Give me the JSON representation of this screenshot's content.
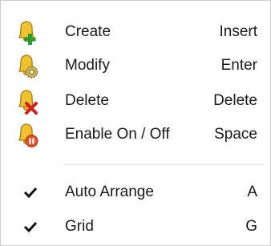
{
  "menu": {
    "items": [
      {
        "label": "Create",
        "shortcut": "Insert",
        "icon": "bell-add-icon",
        "badge_color": "#2e9b2e"
      },
      {
        "label": "Modify",
        "shortcut": "Enter",
        "icon": "bell-gear-icon",
        "badge_color": "#c8b25a"
      },
      {
        "label": "Delete",
        "shortcut": "Delete",
        "icon": "bell-delete-icon",
        "badge_color": "#d21f1f"
      },
      {
        "label": "Enable On / Off",
        "shortcut": "Space",
        "icon": "bell-toggle-icon",
        "badge_color": "#e4502c"
      }
    ],
    "toggles": [
      {
        "label": "Auto Arrange",
        "shortcut": "A",
        "checked": true
      },
      {
        "label": "Grid",
        "shortcut": "G",
        "checked": true
      }
    ],
    "bell_color": "#f2c12e"
  }
}
